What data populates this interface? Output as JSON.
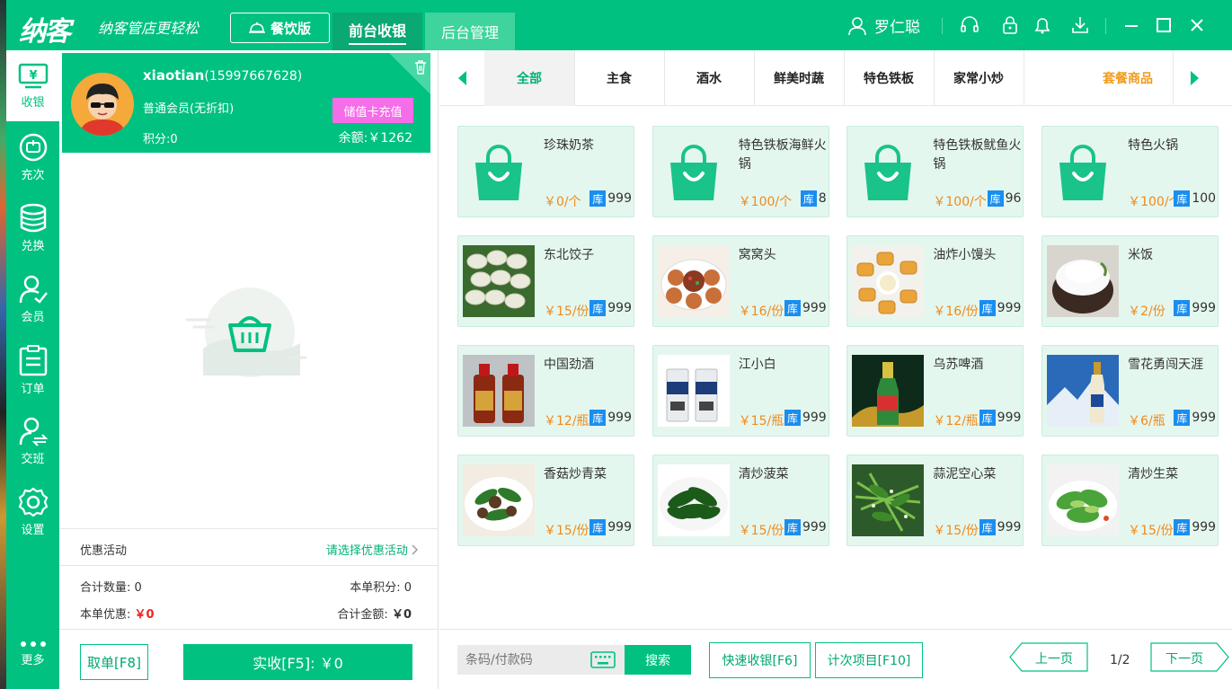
{
  "header": {
    "logo": "纳客",
    "slogan": "纳客管店更轻松",
    "edition": "餐饮版",
    "tabs": [
      {
        "label": "前台收银"
      },
      {
        "label": "后台管理"
      }
    ],
    "user": "罗仁聪",
    "icons": [
      "headset-icon",
      "lock-icon",
      "bell-icon",
      "download-icon",
      "minimize-icon",
      "maximize-icon",
      "close-icon"
    ]
  },
  "sidebar": {
    "items": [
      {
        "label": "收银",
        "icon": "cashier-icon"
      },
      {
        "label": "充次",
        "icon": "recharge-count-icon"
      },
      {
        "label": "兑换",
        "icon": "exchange-icon"
      },
      {
        "label": "会员",
        "icon": "member-icon"
      },
      {
        "label": "订单",
        "icon": "order-icon"
      },
      {
        "label": "交班",
        "icon": "shift-icon"
      },
      {
        "label": "设置",
        "icon": "settings-icon"
      },
      {
        "label": "更多",
        "icon": "more-icon"
      }
    ]
  },
  "member": {
    "name": "xiaotian",
    "phone": "(15997667628)",
    "level": "普通会员(无折扣)",
    "points": "积分:0",
    "balance": "余额:￥1262",
    "recharge_label": "储值卡充值"
  },
  "promotion": {
    "label": "优惠活动",
    "select": "请选择优惠活动"
  },
  "summary": {
    "qty_label": "合计数量:",
    "qty": "0",
    "points_label": "本单积分:",
    "points": "0",
    "discount_label": "本单优惠:",
    "discount": "￥0",
    "total_label": "合计金额:",
    "total": "￥0"
  },
  "actions": {
    "cancel": "取单[F8]",
    "pay": "实收[F5]: ￥0"
  },
  "categories": [
    "全部",
    "主食",
    "酒水",
    "鲜美时蔬",
    "特色铁板",
    "家常小炒"
  ],
  "combo_category": "套餐商品",
  "products": [
    {
      "name": "珍珠奶茶",
      "price": "￥0/个",
      "stock": "999",
      "image": "shopping-bag-icon"
    },
    {
      "name": "特色铁板海鲜火锅",
      "price": "￥100/个",
      "stock": "8",
      "image": "shopping-bag-icon"
    },
    {
      "name": "特色铁板鱿鱼火锅",
      "price": "￥100/个",
      "stock": "96",
      "image": "shopping-bag-icon"
    },
    {
      "name": "特色火锅",
      "price": "￥100/个",
      "stock": "100",
      "image": "shopping-bag-icon"
    },
    {
      "name": "东北饺子",
      "price": "￥15/份",
      "stock": "999",
      "image": "dumplings-photo"
    },
    {
      "name": "窝窝头",
      "price": "￥16/份",
      "stock": "999",
      "image": "wowotou-photo"
    },
    {
      "name": "油炸小馒头",
      "price": "￥16/份",
      "stock": "999",
      "image": "fried-buns-photo"
    },
    {
      "name": "米饭",
      "price": "￥2/份",
      "stock": "999",
      "image": "rice-photo"
    },
    {
      "name": "中国劲酒",
      "price": "￥12/瓶",
      "stock": "999",
      "image": "jinjiu-photo"
    },
    {
      "name": "江小白",
      "price": "￥15/瓶",
      "stock": "999",
      "image": "jiangxiaobai-photo"
    },
    {
      "name": "乌苏啤酒",
      "price": "￥12/瓶",
      "stock": "999",
      "image": "wusu-beer-photo"
    },
    {
      "name": "雪花勇闯天涯",
      "price": "￥6/瓶",
      "stock": "999",
      "image": "snow-beer-photo"
    },
    {
      "name": "香菇炒青菜",
      "price": "￥15/份",
      "stock": "999",
      "image": "mushroom-greens-photo"
    },
    {
      "name": "清炒菠菜",
      "price": "￥15/份",
      "stock": "999",
      "image": "spinach-photo"
    },
    {
      "name": "蒜泥空心菜",
      "price": "￥15/份",
      "stock": "999",
      "image": "water-spinach-photo"
    },
    {
      "name": "清炒生菜",
      "price": "￥15/份",
      "stock": "999",
      "image": "lettuce-photo"
    }
  ],
  "stock_badge": "库",
  "bottom": {
    "search_placeholder": "条码/付款码",
    "search_btn": "搜索",
    "quick_pay": "快速收银[F6]",
    "count_item": "计次项目[F10]",
    "prev": "上一页",
    "page": "1/2",
    "next": "下一页"
  },
  "colors": {
    "primary": "#00c180",
    "price": "#f08a1c",
    "stock_badge": "#1a8ef0",
    "recharge": "#f56de8",
    "discount": "#ef2323"
  }
}
